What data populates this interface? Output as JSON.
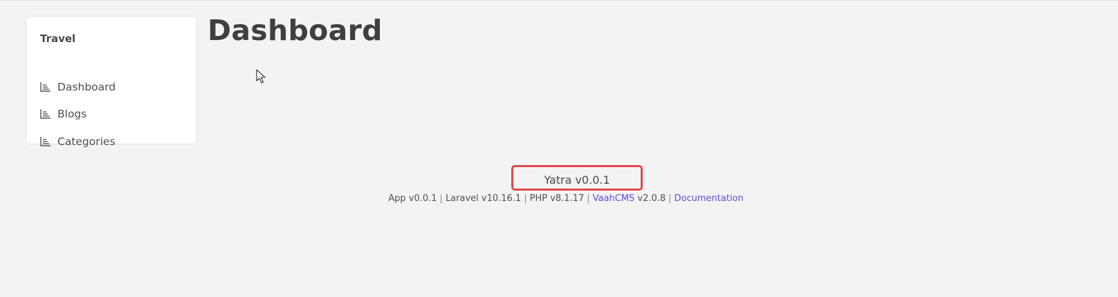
{
  "sidebar": {
    "title": "Travel",
    "items": [
      {
        "label": "Dashboard",
        "icon": "chart-icon"
      },
      {
        "label": "Blogs",
        "icon": "chart-icon"
      },
      {
        "label": "Categories",
        "icon": "chart-icon"
      }
    ]
  },
  "main": {
    "page_title": "Dashboard"
  },
  "footer": {
    "app_name_version": "Yatra v0.0.1",
    "app_version": "App v0.0.1",
    "laravel_version": "Laravel v10.16.1",
    "php_version": "PHP v8.1.17",
    "vaahcms_link": "VaahCMS",
    "vaahcms_version": " v2.0.8",
    "documentation_link": "Documentation",
    "separator": "|"
  },
  "colors": {
    "background": "#f3f3f3",
    "link": "#5a50d6",
    "highlight_border": "#e0474c"
  }
}
